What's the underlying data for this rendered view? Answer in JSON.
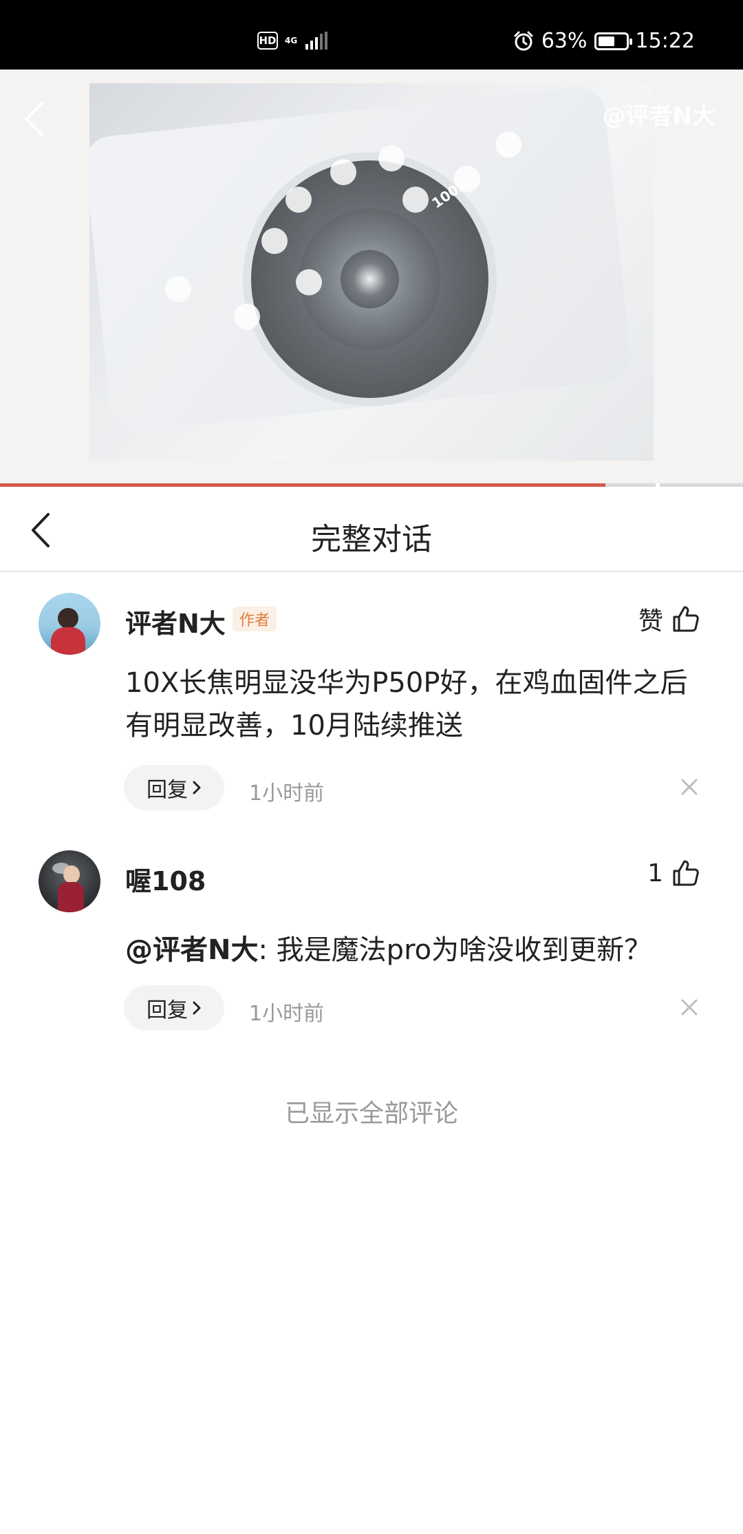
{
  "status_bar": {
    "hd_badge": "HD",
    "network": "4G",
    "battery_percent": "63%",
    "battery_level": 0.63,
    "time": "15:22"
  },
  "hero": {
    "watermark": "@评者N大",
    "camera_label": "100X",
    "gallery_progress": 0.815
  },
  "header": {
    "title": "完整对话"
  },
  "comments": [
    {
      "username": "评者N大",
      "badge": "作者",
      "like_label": "赞",
      "text": "10X长焦明显没华为P50P好，在鸡血固件之后有明显改善，10月陆续推送",
      "reply_label": "回复",
      "time": "1小时前"
    },
    {
      "username": "喔108",
      "like_label": "1",
      "mention": "@评者N大",
      "text": ": 我是魔法pro为啥没收到更新？",
      "reply_label": "回复",
      "time": "1小时前"
    }
  ],
  "footer": {
    "note": "已显示全部评论"
  },
  "colors": {
    "accent_progress": "#d5574b",
    "badge_text": "#e57c3a",
    "badge_bg": "#fbf0e6",
    "muted_text": "#999999"
  },
  "icons": [
    "hd-icon",
    "signal-icon",
    "alarm-icon",
    "battery-icon",
    "back-icon",
    "thumb-up-icon",
    "chevron-right-icon",
    "close-icon"
  ]
}
